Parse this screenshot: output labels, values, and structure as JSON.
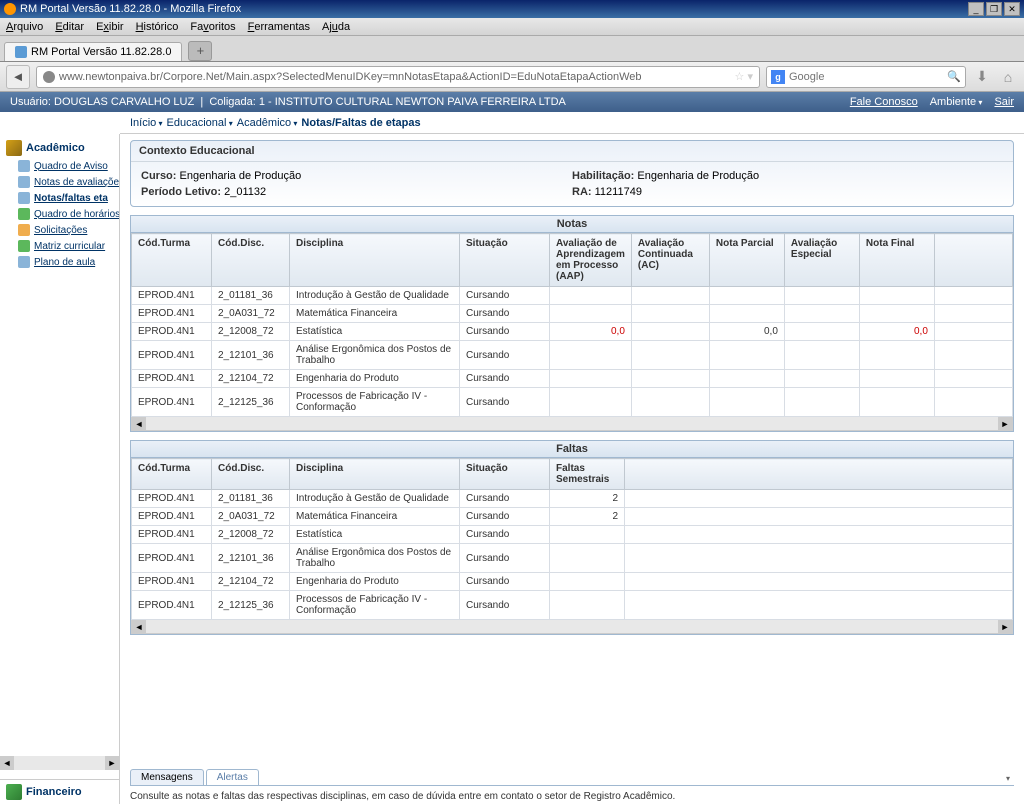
{
  "window": {
    "title": "RM Portal Versão 11.82.28.0 - Mozilla Firefox"
  },
  "menubar": {
    "arquivo": "Arquivo",
    "editar": "Editar",
    "exibir": "Exibir",
    "historico": "Histórico",
    "favoritos": "Favoritos",
    "ferramentas": "Ferramentas",
    "ajuda": "Ajuda"
  },
  "tab": {
    "title": "RM Portal Versão 11.82.28.0"
  },
  "url": "www.newtonpaiva.br/Corpore.Net/Main.aspx?SelectedMenuIDKey=mnNotasEtapa&ActionID=EduNotaEtapaActionWeb",
  "search": {
    "placeholder": "Google"
  },
  "userbar": {
    "user_label": "Usuário:",
    "user_name": "DOUGLAS CARVALHO LUZ",
    "coligada": "Coligada: 1 - INSTITUTO CULTURAL NEWTON PAIVA FERREIRA LTDA",
    "fale": "Fale Conosco",
    "ambiente": "Ambiente",
    "sair": "Sair"
  },
  "breadcrumb": {
    "inicio": "Início",
    "educ": "Educacional",
    "acad": "Acadêmico",
    "current": "Notas/Faltas de etapas"
  },
  "sidebar": {
    "academico": "Acadêmico",
    "items": [
      {
        "label": "Quadro de Aviso"
      },
      {
        "label": "Notas de avaliaçõe"
      },
      {
        "label": "Notas/faltas eta"
      },
      {
        "label": "Quadro de horários"
      },
      {
        "label": "Solicitações"
      },
      {
        "label": "Matriz curricular"
      },
      {
        "label": "Plano de aula"
      }
    ],
    "financeiro": "Financeiro"
  },
  "context": {
    "title": "Contexto Educacional",
    "curso_label": "Curso:",
    "curso_val": "Engenharia de Produção",
    "periodo_label": "Período Letivo:",
    "periodo_val": "2_01132",
    "hab_label": "Habilitação:",
    "hab_val": "Engenharia de Produção",
    "ra_label": "RA:",
    "ra_val": "11211749"
  },
  "notas": {
    "title": "Notas",
    "headers": {
      "turma": "Cód.Turma",
      "disc": "Cód.Disc.",
      "disciplina": "Disciplina",
      "situacao": "Situação",
      "aap": "Avaliação de Aprendizagem em Processo (AAP)",
      "ac": "Avaliação Continuada (AC)",
      "parcial": "Nota Parcial",
      "especial": "Avaliação Especial",
      "final": "Nota Final"
    },
    "rows": [
      {
        "turma": "EPROD.4N1",
        "disc": "2_01181_36",
        "disciplina": "Introdução à Gestão de Qualidade",
        "sit": "Cursando",
        "aap": "",
        "ac": "",
        "parcial": "",
        "esp": "",
        "final": ""
      },
      {
        "turma": "EPROD.4N1",
        "disc": "2_0A031_72",
        "disciplina": "Matemática Financeira",
        "sit": "Cursando",
        "aap": "",
        "ac": "",
        "parcial": "",
        "esp": "",
        "final": ""
      },
      {
        "turma": "EPROD.4N1",
        "disc": "2_12008_72",
        "disciplina": "Estatística",
        "sit": "Cursando",
        "aap": "0,0",
        "ac": "",
        "parcial": "0,0",
        "esp": "",
        "final": "0,0"
      },
      {
        "turma": "EPROD.4N1",
        "disc": "2_12101_36",
        "disciplina": "Análise Ergonômica dos Postos de Trabalho",
        "sit": "Cursando",
        "aap": "",
        "ac": "",
        "parcial": "",
        "esp": "",
        "final": ""
      },
      {
        "turma": "EPROD.4N1",
        "disc": "2_12104_72",
        "disciplina": "Engenharia do Produto",
        "sit": "Cursando",
        "aap": "",
        "ac": "",
        "parcial": "",
        "esp": "",
        "final": ""
      },
      {
        "turma": "EPROD.4N1",
        "disc": "2_12125_36",
        "disciplina": "Processos de Fabricação IV - Conformação",
        "sit": "Cursando",
        "aap": "",
        "ac": "",
        "parcial": "",
        "esp": "",
        "final": ""
      }
    ]
  },
  "faltas": {
    "title": "Faltas",
    "headers": {
      "turma": "Cód.Turma",
      "disc": "Cód.Disc.",
      "disciplina": "Disciplina",
      "situacao": "Situação",
      "sem": "Faltas Semestrais"
    },
    "rows": [
      {
        "turma": "EPROD.4N1",
        "disc": "2_01181_36",
        "disciplina": "Introdução à Gestão de Qualidade",
        "sit": "Cursando",
        "sem": "2"
      },
      {
        "turma": "EPROD.4N1",
        "disc": "2_0A031_72",
        "disciplina": "Matemática Financeira",
        "sit": "Cursando",
        "sem": "2"
      },
      {
        "turma": "EPROD.4N1",
        "disc": "2_12008_72",
        "disciplina": "Estatística",
        "sit": "Cursando",
        "sem": ""
      },
      {
        "turma": "EPROD.4N1",
        "disc": "2_12101_36",
        "disciplina": "Análise Ergonômica dos Postos de Trabalho",
        "sit": "Cursando",
        "sem": ""
      },
      {
        "turma": "EPROD.4N1",
        "disc": "2_12104_72",
        "disciplina": "Engenharia do Produto",
        "sit": "Cursando",
        "sem": ""
      },
      {
        "turma": "EPROD.4N1",
        "disc": "2_12125_36",
        "disciplina": "Processos de Fabricação IV - Conformação",
        "sit": "Cursando",
        "sem": ""
      }
    ]
  },
  "bottom": {
    "tab1": "Mensagens",
    "tab2": "Alertas",
    "msg": "Consulte as notas e faltas das respectivas disciplinas, em caso de dúvida entre em contato o setor de Registro Acadêmico."
  }
}
